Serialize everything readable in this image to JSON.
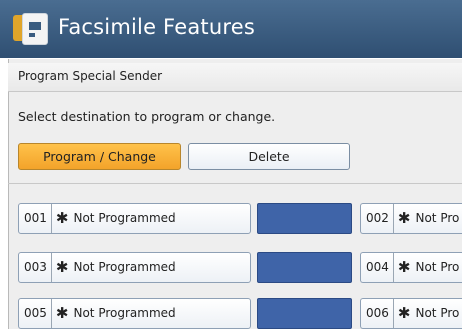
{
  "header": {
    "title": "Facsimile Features"
  },
  "section": {
    "title": "Program Special Sender",
    "instruction": "Select destination to program or change."
  },
  "actions": {
    "program_label": "Program / Change",
    "delete_label": "Delete"
  },
  "destinations": [
    {
      "number": "001",
      "mark": "✱",
      "label": "Not Programmed"
    },
    {
      "number": "002",
      "mark": "✱",
      "label": "Not Pro"
    },
    {
      "number": "003",
      "mark": "✱",
      "label": "Not Programmed"
    },
    {
      "number": "004",
      "mark": "✱",
      "label": "Not Pro"
    },
    {
      "number": "005",
      "mark": "✱",
      "label": "Not Programmed"
    },
    {
      "number": "006",
      "mark": "✱",
      "label": "Not Pro"
    }
  ],
  "colors": {
    "title_bar": "#3a5c80",
    "selected_button": "#f6b03c",
    "swatch": "#3f64a8"
  },
  "icons": {
    "app": "facsimile-app-icon"
  }
}
